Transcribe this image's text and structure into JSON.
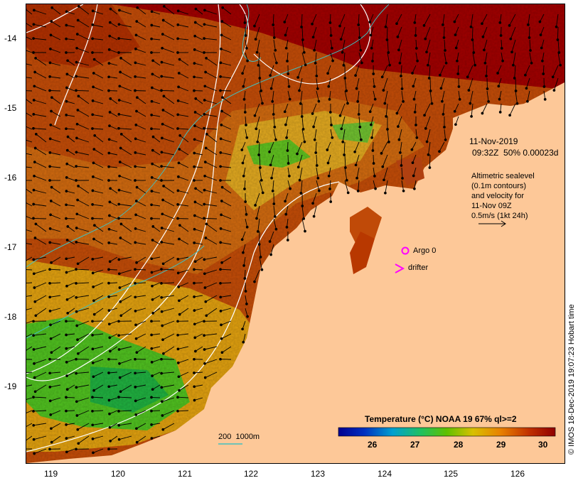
{
  "map": {
    "lat_ticks": [
      "-14",
      "-15",
      "-16",
      "-17",
      "-18",
      "-19"
    ],
    "lon_ticks": [
      "119",
      "120",
      "121",
      "122",
      "123",
      "124",
      "125",
      "126"
    ],
    "date_line1": "11-Nov-2019",
    "date_line2": "09:32Z  50% 0.00023d",
    "altimetry_lines": [
      "Altimetric sealevel",
      "(0.1m contours)",
      "and velocity for",
      "11-Nov 09Z",
      "0.5m/s (1kt 24h)"
    ],
    "argo_label": "Argo 0",
    "drifter_label": "drifter",
    "bathy_label": "200  1000m",
    "colorbar_title": "Temperature (°C) NOAA 19 67% ql>=2",
    "colorbar_ticks": [
      "26",
      "27",
      "28",
      "29",
      "30"
    ],
    "credit": "© IMOS 18-Dec-2019 19:07:23 Hobart time"
  },
  "colors": {
    "land": "#fdc898",
    "warm_sea": "#b83800",
    "hot_sea": "#a00000",
    "mid_sea": "#d87a10",
    "cool_sea": "#e8c020",
    "green_sea": "#40c020",
    "contour": "#ffffff",
    "isobath": "#40c0c0",
    "argo": "#ff00ff"
  }
}
